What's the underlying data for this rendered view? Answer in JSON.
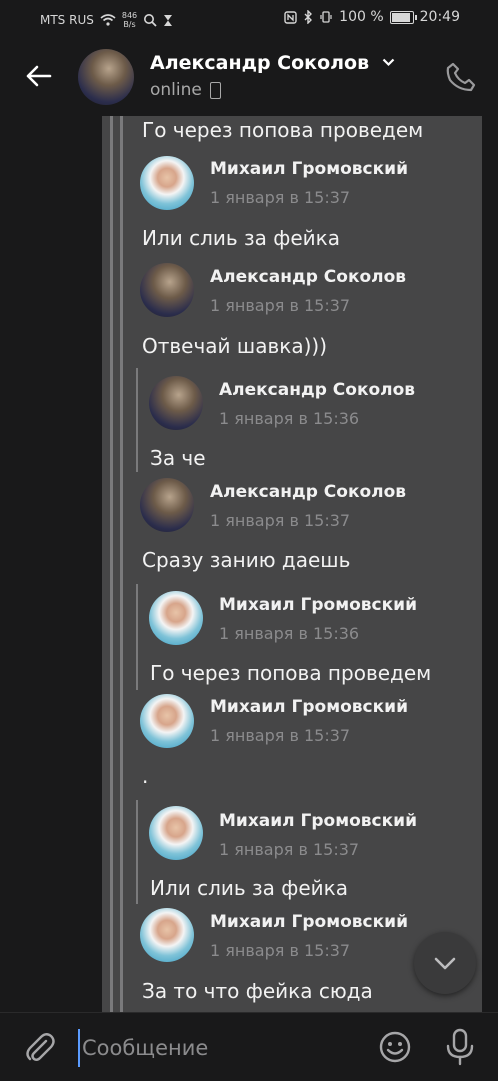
{
  "statusbar": {
    "carrier": "MTS RUS",
    "net_speed_value": "846",
    "net_speed_unit": "B/s",
    "battery": "100 %",
    "battery_level": 1.0,
    "time": "20:49"
  },
  "header": {
    "name": "Александр Соколов",
    "status": "online",
    "icons": [
      "back-arrow-icon",
      "chevron-down-icon",
      "mobile-phone-icon",
      "phone-call-icon"
    ]
  },
  "messages": [
    {
      "text": "Го через попова проведем"
    },
    {
      "sender": "Михаил Громовский",
      "time": "1 января в 15:37",
      "text": "Или слиь за фейка"
    },
    {
      "sender": "Александр Соколов",
      "time": "1 января в 15:37",
      "text": "Отвечай шавка)))"
    },
    {
      "sender": "Александр Соколов",
      "time": "1 января в 15:36",
      "text": "За че"
    },
    {
      "sender": "Александр Соколов",
      "time": "1 января в 15:37",
      "text": "Сразу занию даешь"
    },
    {
      "sender": "Михаил Громовский",
      "time": "1 января в 15:36",
      "text": "Го через попова проведем"
    },
    {
      "sender": "Михаил Громовский",
      "time": "1 января в 15:37",
      "text": "."
    },
    {
      "sender": "Михаил Громовский",
      "time": "1 января в 15:37",
      "text": "Или слиь за фейка"
    },
    {
      "sender": "Михаил Громовский",
      "time": "1 января в 15:37",
      "text": "За то что фейка сюда"
    }
  ],
  "composer": {
    "placeholder": "Сообщение",
    "icons": [
      "paperclip-icon",
      "emoji-icon",
      "microphone-icon"
    ]
  },
  "colors": {
    "background": "#19191a",
    "bubble": "#464647",
    "accent": "#5b9cff"
  }
}
